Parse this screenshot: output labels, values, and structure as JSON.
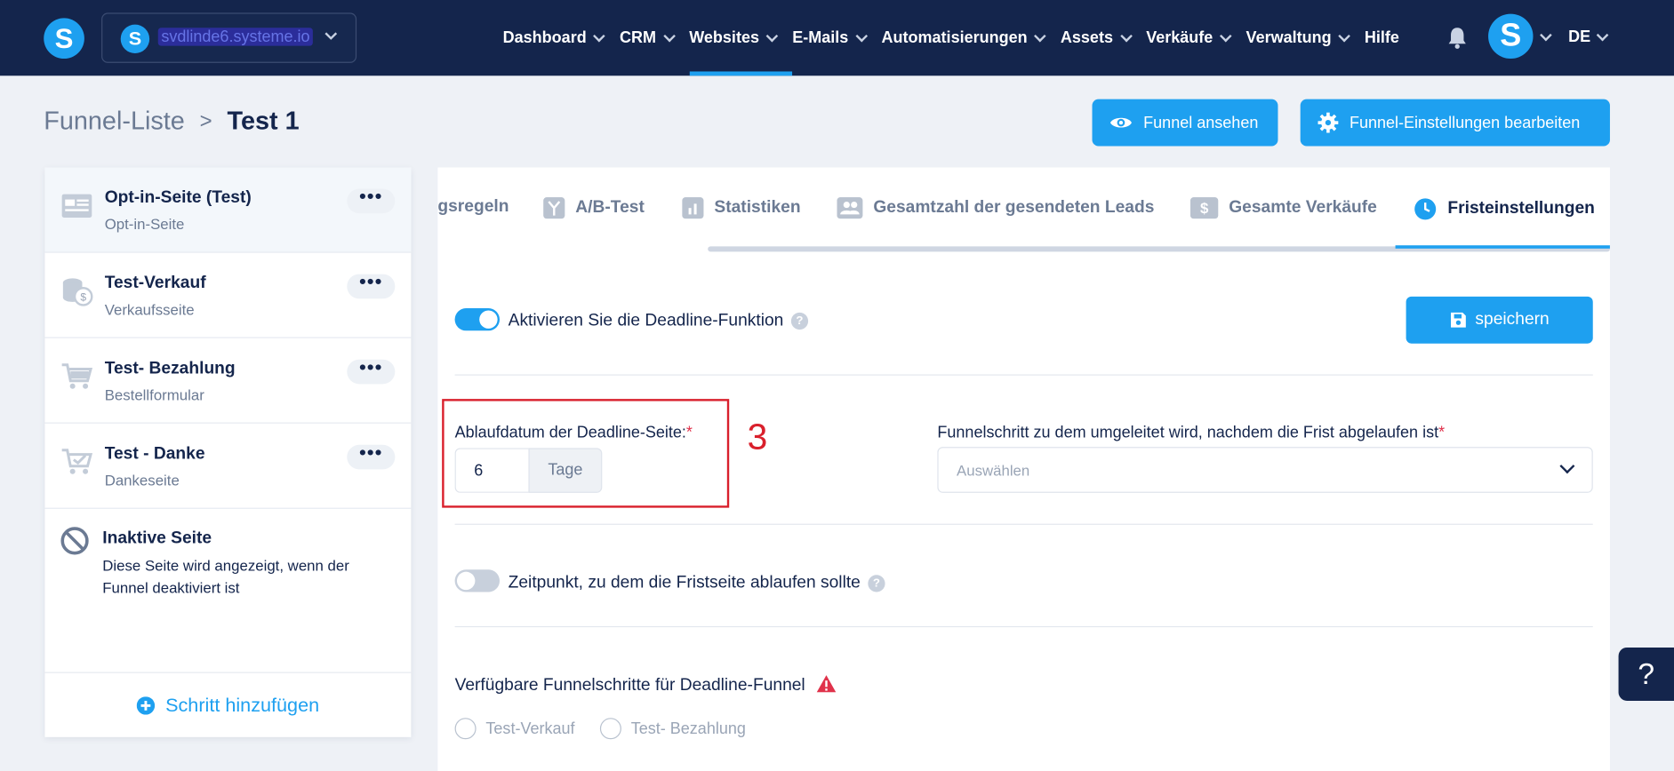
{
  "topbar": {
    "logo_letter": "S",
    "site_name": "svdlinde6.systeme.io",
    "nav": [
      {
        "label": "Dashboard"
      },
      {
        "label": "CRM"
      },
      {
        "label": "Websites"
      },
      {
        "label": "E-Mails"
      },
      {
        "label": "Automatisierungen"
      },
      {
        "label": "Assets"
      },
      {
        "label": "Verkäufe"
      },
      {
        "label": "Verwaltung"
      },
      {
        "label": "Hilfe"
      }
    ],
    "active_nav": "Websites",
    "avatar_letter": "S",
    "language": "DE"
  },
  "header": {
    "breadcrumb_root": "Funnel-Liste",
    "breadcrumb_sep": ">",
    "breadcrumb_current": "Test 1",
    "view_button": "Funnel ansehen",
    "settings_button": "Funnel-Einstellungen bearbeiten"
  },
  "sidebar": {
    "steps": [
      {
        "title": "Opt-in-Seite (Test)",
        "subtitle": "Opt-in-Seite",
        "icon": "form-page-icon",
        "more": "•••"
      },
      {
        "title": "Test-Verkauf",
        "subtitle": "Verkaufsseite",
        "icon": "coins-icon",
        "more": "•••"
      },
      {
        "title": "Test- Bezahlung",
        "subtitle": "Bestellformular",
        "icon": "cart-icon",
        "more": "•••"
      },
      {
        "title": "Test - Danke",
        "subtitle": "Dankeseite",
        "icon": "cart-check-icon",
        "more": "•••"
      }
    ],
    "inactive": {
      "title": "Inaktive Seite",
      "description": "Diese Seite wird angezeigt, wenn der Funnel deaktiviert ist"
    },
    "add_step": "Schritt hinzufügen"
  },
  "tabs": [
    {
      "label": "gsregeln",
      "icon": ""
    },
    {
      "label": "A/B-Test",
      "icon": "split-icon"
    },
    {
      "label": "Statistiken",
      "icon": "bar-chart-icon"
    },
    {
      "label": "Gesamtzahl der gesendeten Leads",
      "icon": "people-icon"
    },
    {
      "label": "Gesamte Verkäufe",
      "icon": "dollar-icon"
    },
    {
      "label": "Fristeinstellungen",
      "icon": "clock-icon"
    }
  ],
  "active_tab": "Fristeinstellungen",
  "deadline": {
    "enable_label": "Aktivieren Sie die Deadline-Funktion",
    "enabled": true,
    "save_button": "speichern",
    "expiry_label": "Ablaufdatum der Deadline-Seite:",
    "required_mark": "*",
    "expiry_value": "6",
    "expiry_unit": "Tage",
    "annotation": "3",
    "redirect_label": "Funnelschritt zu dem umgeleitet wird, nachdem die Frist abgelaufen ist",
    "redirect_placeholder": "Auswählen",
    "time_label": "Zeitpunkt, zu dem die Fristseite ablaufen sollte",
    "time_enabled": false,
    "available_label": "Verfügbare Funnelschritte für Deadline-Funnel",
    "available_steps": [
      "Test-Verkauf",
      "Test- Bezahlung"
    ]
  },
  "help_button": "?",
  "colors": {
    "nav_bg": "#14254c",
    "accent": "#1ea0f0",
    "annotation_red": "#d9202c"
  }
}
